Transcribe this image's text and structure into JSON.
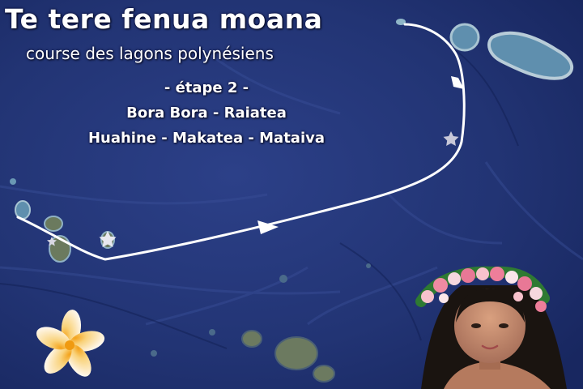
{
  "title": "Te tere fenua moana",
  "subtitle": "course des lagons polynésiens",
  "stage": {
    "number": "- étape 2 -",
    "line1": "Bora Bora - Raiatea",
    "line2": "Huahine  -  Makatea - Mataiva"
  },
  "colors": {
    "ocean": "#24377a",
    "route": "#ffffff",
    "star": "#e8e8f0",
    "island": "#7d8a6a",
    "lagoon": "#6fa6c8"
  },
  "icons": [
    "star-marker-icon",
    "arrow-icon",
    "tiare-flower-icon"
  ]
}
